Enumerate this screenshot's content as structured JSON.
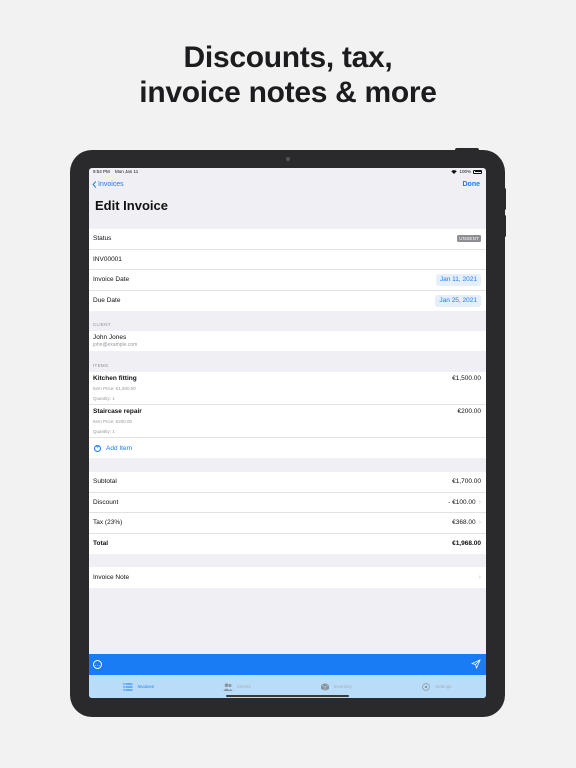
{
  "headline": {
    "line1": "Discounts, tax,",
    "line2": "invoice notes & more"
  },
  "status_bar": {
    "time": "9:54 PM",
    "date": "Mon Jan 11",
    "battery": "100%"
  },
  "nav": {
    "back_label": "Invoices",
    "done_label": "Done",
    "title": "Edit Invoice"
  },
  "details": {
    "status_label": "Status",
    "status_value": "UNSENT",
    "invoice_number": "INV00001",
    "invoice_date_label": "Invoice Date",
    "invoice_date": "Jan 11, 2021",
    "due_date_label": "Due Date",
    "due_date": "Jan 25, 2021"
  },
  "client": {
    "section": "CLIENT",
    "name": "John Jones",
    "email": "john@example.com"
  },
  "items": {
    "section": "ITEMS",
    "list": [
      {
        "name": "Kitchen fitting",
        "price_line": "Item Price: €1,500.00",
        "qty_line": "Quantity: 1",
        "total": "€1,500.00"
      },
      {
        "name": "Staircase repair",
        "price_line": "Item Price: €200.00",
        "qty_line": "Quantity: 1",
        "total": "€200.00"
      }
    ],
    "add_label": "Add Item"
  },
  "totals": {
    "subtotal_label": "Subtotal",
    "subtotal": "€1,700.00",
    "discount_label": "Discount",
    "discount": "- €100.00",
    "tax_label": "Tax (23%)",
    "tax": "€368.00",
    "total_label": "Total",
    "total": "€1,968.00"
  },
  "note": {
    "label": "Invoice Note"
  },
  "tabs": [
    {
      "label": "Invoices",
      "active": true
    },
    {
      "label": "Clients",
      "active": false
    },
    {
      "label": "Inventory",
      "active": false
    },
    {
      "label": "Settings",
      "active": false
    }
  ],
  "colors": {
    "accent": "#1a7cf4",
    "tabbar": "#b9ddf8",
    "device": "#2a2a2c"
  }
}
